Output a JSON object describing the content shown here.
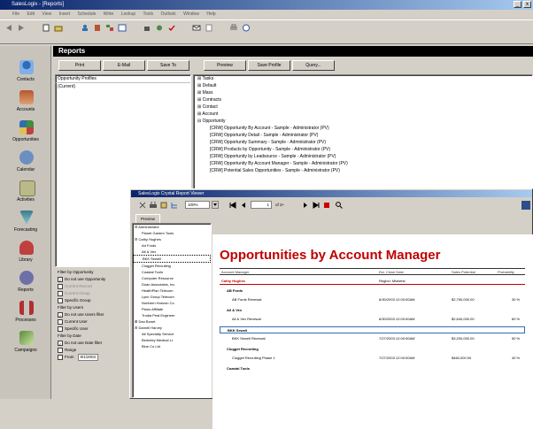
{
  "window": {
    "title": "SalesLogix - [Reports]",
    "btn_min": "_",
    "btn_close": "x"
  },
  "menu": [
    "File",
    "Edit",
    "View",
    "Insert",
    "Schedule",
    "Write",
    "Lookup",
    "Tools",
    "Outlook",
    "Window",
    "Help"
  ],
  "shortcuts": [
    {
      "label": "Contacts",
      "color": "#2f6db5"
    },
    {
      "label": "Accounts",
      "color": "#b5562f"
    },
    {
      "label": "Opportunities",
      "color": "#3e8f3e"
    },
    {
      "label": "Calendar",
      "color": "#6b8fc0"
    },
    {
      "label": "Activities",
      "color": "#9b9b5c"
    },
    {
      "label": "Forecasting",
      "color": "#3a7a8a"
    },
    {
      "label": "Library",
      "color": "#c04040"
    },
    {
      "label": "Reports",
      "color": "#6f6fa8"
    },
    {
      "label": "Processes",
      "color": "#b03030"
    },
    {
      "label": "Campaigns",
      "color": "#5a8a3a"
    }
  ],
  "reports": {
    "header": "Reports",
    "buttons": [
      "Print",
      "E-Mail",
      "Save To",
      "Preview",
      "Save Profile",
      "Query..."
    ],
    "profiles_label": "Opportunity Profiles",
    "profile_value": "(Current)",
    "tree": [
      "Tasks",
      "Default",
      "Mass",
      "Contracts",
      "Contact",
      "Account",
      "Opportunity",
      "[CRW] Opportunity By Account - Sample - Administrator (PV)",
      "[CRW] Opportunity Detail - Sample - Administrator (PV)",
      "[CRW] Opportunity Summary - Sample - Administrator (PV)",
      "[CRW] Products by Opportunity - Sample - Administrator (PV)",
      "[CRW] Opportunity by Leadsource - Sample - Administrator (PV)",
      "[CRW] Opportunity By Account Manager - Sample - Administrator (PV)",
      "[CRW] Potential Sales Opportunities - Sample - Administrator (PV)"
    ],
    "filters": [
      {
        "label": "Filter by Opportunity",
        "checked": false
      },
      {
        "label": "Do not use Opportunity",
        "checked": true
      },
      {
        "label": "Current Record",
        "checked": false
      },
      {
        "label": "Current Group",
        "checked": false
      },
      {
        "label": "Specific Group",
        "checked": false
      },
      {
        "label": "Filter by Users",
        "checked": false
      },
      {
        "label": "Do not use Users filter",
        "checked": true
      },
      {
        "label": "Current User",
        "checked": false
      },
      {
        "label": "Specific User",
        "checked": false
      },
      {
        "label": "Filter by Date",
        "checked": false
      },
      {
        "label": "Do not use Date filter",
        "checked": true
      },
      {
        "label": "Range",
        "checked": false
      },
      {
        "label": "From",
        "checked": false
      }
    ],
    "from_value": "9/1/2003"
  },
  "viewer": {
    "title": "SalesLogix Crystal Report Viewer",
    "zoom": "100%",
    "page_of": "of 2+",
    "page_num": "1",
    "tab": "Preview",
    "group_tree": [
      "Administrator",
      "Planet Garden Tools",
      "Cathy Hughes",
      "Ad Fords",
      "Alt & Vex",
      "BKK Sewell",
      "Clugget Recruiting",
      "Coastal Tools",
      "Computer Resource",
      "Doan Associates, Inc",
      "HealthPlan Telecom",
      "Lynn Group Telecom",
      "Northern Horizon Co",
      "Plano Affiliate",
      "Trudia Peal Engineer",
      "Dan Bonet",
      "Darnell Harvey",
      "Alt Specialty Service",
      "Berkeley Medical Lt",
      "Blue Co Ltd"
    ],
    "report_title": "Opportunities by Account Manager",
    "columns": [
      "Account Manager",
      "Est. Close Date",
      "Sales Potential",
      "Probability"
    ],
    "manager": "Cathy Hughes",
    "region": "Region: Midwest",
    "rows": [
      {
        "type": "group",
        "text": "AB Fords"
      },
      {
        "type": "detail",
        "text": "AB Fords Renewal",
        "date": "6/30/2003 12:00:00AM",
        "amount": "$2,760,000.00",
        "prob": "30 %"
      },
      {
        "type": "group",
        "text": "All & Vex"
      },
      {
        "type": "detail",
        "text": "All & Vex Renewal",
        "date": "6/30/2003 12:00:00AM",
        "amount": "$2,640,000.00",
        "prob": "60 %"
      },
      {
        "type": "group",
        "text": "BKK Sewell"
      },
      {
        "type": "detail",
        "text": "BKK Sewell Renewal",
        "date": "7/27/2003 12:00:00AM",
        "amount": "$3,200,000.00",
        "prob": "50 %"
      },
      {
        "type": "group",
        "text": "Clugget Recruiting"
      },
      {
        "type": "detail",
        "text": "Clugget Recruiting Phase 1",
        "date": "7/27/2003 12:00:00AM",
        "amount": "$460,000.00",
        "prob": "40 %"
      },
      {
        "type": "group",
        "text": "Coastal Tools"
      }
    ]
  }
}
